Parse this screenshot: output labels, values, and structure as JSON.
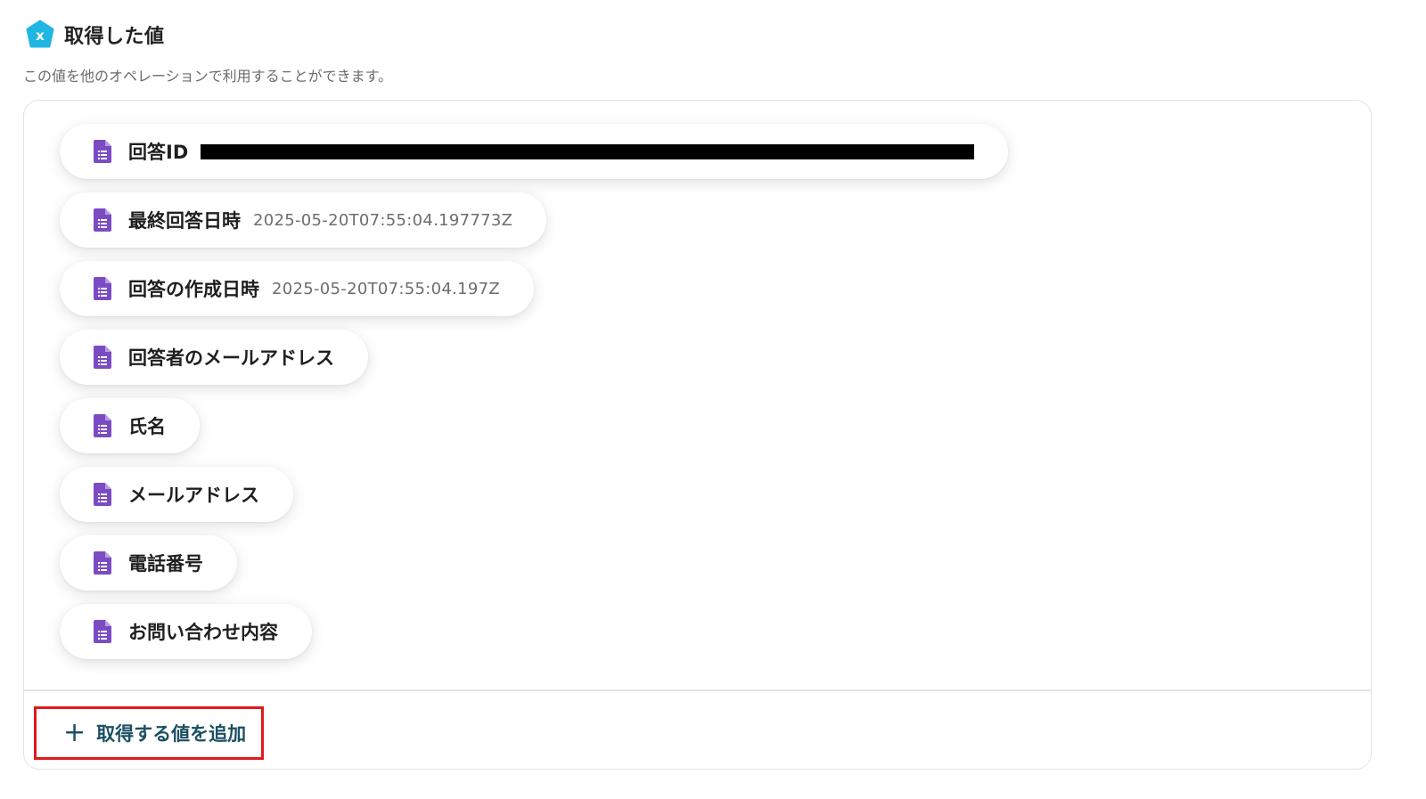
{
  "header": {
    "title": "取得した値",
    "icon": "x-variable-icon",
    "icon_color": "#1fb6e3"
  },
  "subtitle": "この値を他のオペレーションで利用することができます。",
  "fields": [
    {
      "label": "回答ID",
      "value": "",
      "redacted": true
    },
    {
      "label": "最終回答日時",
      "value": "2025-05-20T07:55:04.197773Z"
    },
    {
      "label": "回答の作成日時",
      "value": "2025-05-20T07:55:04.197Z"
    },
    {
      "label": "回答者のメールアドレス",
      "value": ""
    },
    {
      "label": "氏名",
      "value": ""
    },
    {
      "label": "メールアドレス",
      "value": ""
    },
    {
      "label": "電話番号",
      "value": ""
    },
    {
      "label": "お問い合わせ内容",
      "value": ""
    }
  ],
  "field_icon": "google-forms-doc-icon",
  "field_icon_color": "#7b4bc4",
  "add_button": {
    "label": "取得する値を追加",
    "icon": "plus-icon",
    "color": "#1c4f63",
    "highlight_color": "#e0191e"
  }
}
